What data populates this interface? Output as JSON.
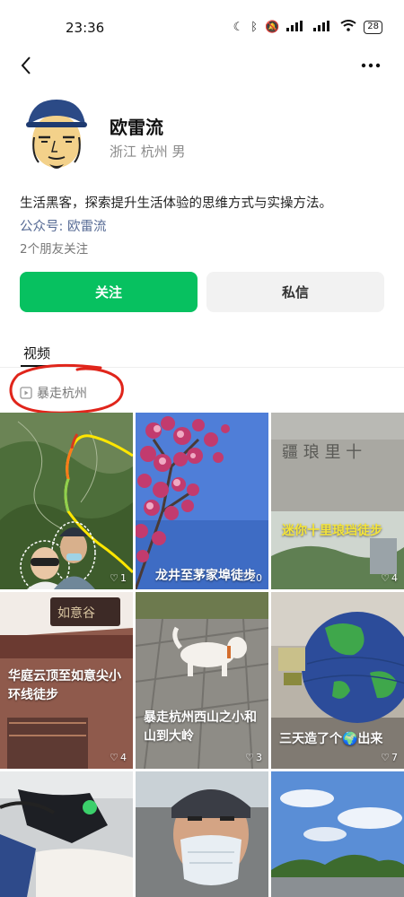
{
  "status_bar": {
    "time": "23:36",
    "battery": "28",
    "icons": [
      "moon-icon",
      "bluetooth-icon",
      "mute-icon",
      "hd-signal-icon",
      "signal-icon",
      "hd-signal-icon",
      "signal-icon",
      "wifi-icon",
      "battery-icon"
    ]
  },
  "navbar": {
    "back_icon": "chevron-left-icon",
    "more_icon": "more-horizontal-icon"
  },
  "profile": {
    "name": "欧雷流",
    "meta": "浙江 杭州 男",
    "bio": "生活黑客，探索提升生活体验的思维方式与实操方法。",
    "official_account": "公众号: 欧雷流",
    "friends": "2个朋友关注"
  },
  "actions": {
    "follow": "关注",
    "message": "私信"
  },
  "tabs": {
    "video": "视频"
  },
  "collection": {
    "label": "暴走杭州",
    "icon": "play-square-icon"
  },
  "videos": [
    {
      "caption": "",
      "likes": "1",
      "caption_color": "white"
    },
    {
      "caption": "龙井至茅家埠徒步",
      "likes": "20",
      "caption_color": "yellow"
    },
    {
      "caption": "迷你十里琅珰徒步",
      "likes": "4",
      "caption_color": "yellow"
    },
    {
      "caption": "华庭云顶至如意尖小环线徒步",
      "likes": "4",
      "caption_color": "white"
    },
    {
      "caption": "暴走杭州西山之小和山到大岭",
      "likes": "3",
      "caption_color": "white"
    },
    {
      "caption": "三天造了个🌍出来",
      "likes": "7",
      "caption_color": "white"
    },
    {
      "caption": "",
      "likes": "",
      "caption_color": "white"
    },
    {
      "caption": "",
      "likes": "",
      "caption_color": "white"
    },
    {
      "caption": "",
      "likes": "",
      "caption_color": "white"
    }
  ],
  "colors": {
    "accent_green": "#07c160",
    "link_blue": "#576b95",
    "annotation_red": "#e0251b"
  }
}
